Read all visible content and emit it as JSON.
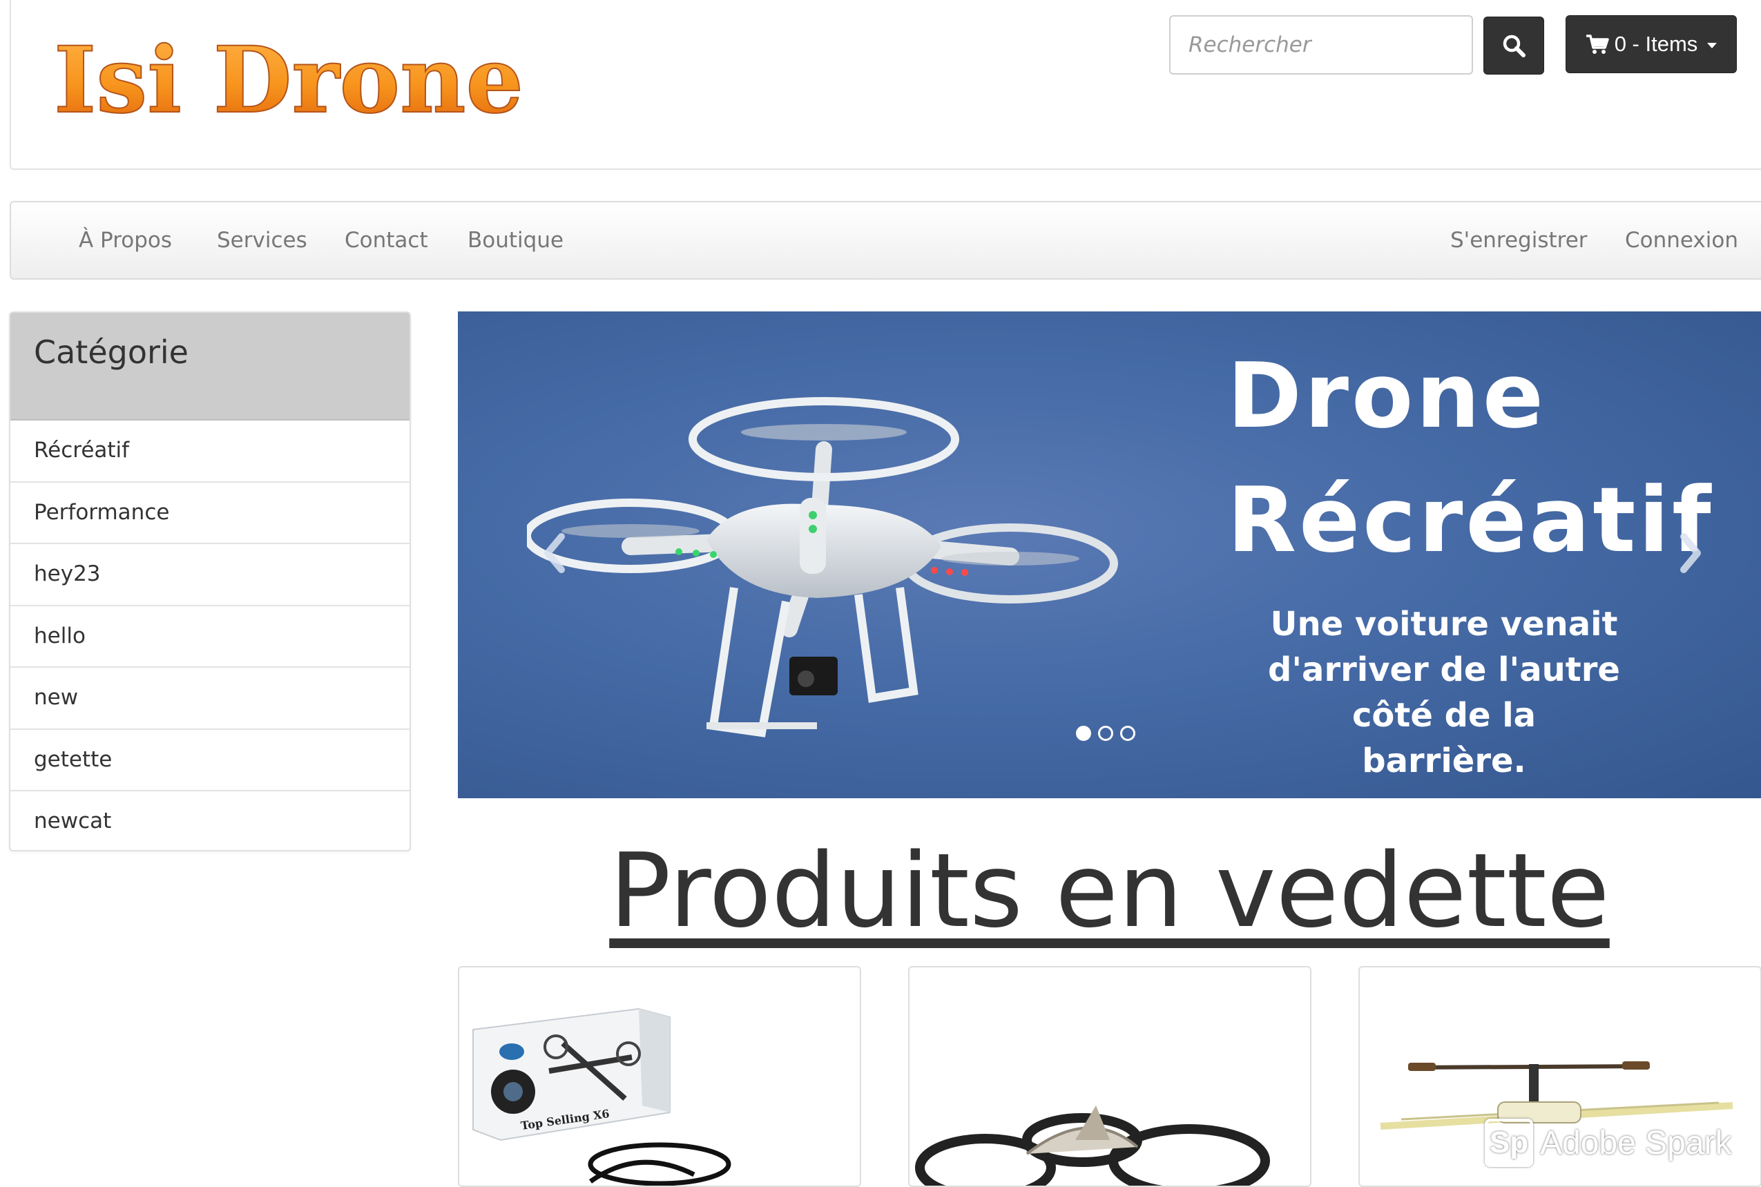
{
  "brand": {
    "logo_text": "Isi Drone",
    "logo_color": "#f7941d"
  },
  "search": {
    "placeholder": "Rechercher",
    "button_icon": "search-icon"
  },
  "cart": {
    "label": "0 - Items",
    "icon": "cart-icon"
  },
  "nav": {
    "left": [
      {
        "label": "À Propos"
      },
      {
        "label": "Services"
      },
      {
        "label": "Contact"
      },
      {
        "label": "Boutique"
      }
    ],
    "right": [
      {
        "label": "S'enregistrer"
      },
      {
        "label": "Connexion"
      }
    ]
  },
  "sidebar": {
    "title": "Catégorie",
    "items": [
      {
        "label": "Récréatif"
      },
      {
        "label": "Performance"
      },
      {
        "label": "hey23"
      },
      {
        "label": "hello"
      },
      {
        "label": "new"
      },
      {
        "label": "getette"
      },
      {
        "label": "newcat"
      }
    ]
  },
  "carousel": {
    "title_line1": "Drone",
    "title_line2": "Récréatif",
    "subtitle": "Une voiture venait\nd'arriver de l'autre\ncôté de la barrière.",
    "slide_count": 3,
    "active_slide": 1,
    "background_color": "#456aa5"
  },
  "featured": {
    "title": "Produits en vedette",
    "products": [
      {
        "image": "quadcopter-box-product",
        "box_text": "Top Selling X6"
      },
      {
        "image": "ar-drone-product"
      },
      {
        "image": "rc-helicopter-product"
      }
    ]
  },
  "watermark": {
    "icon_text": "Sp",
    "text": "Adobe Spark"
  }
}
